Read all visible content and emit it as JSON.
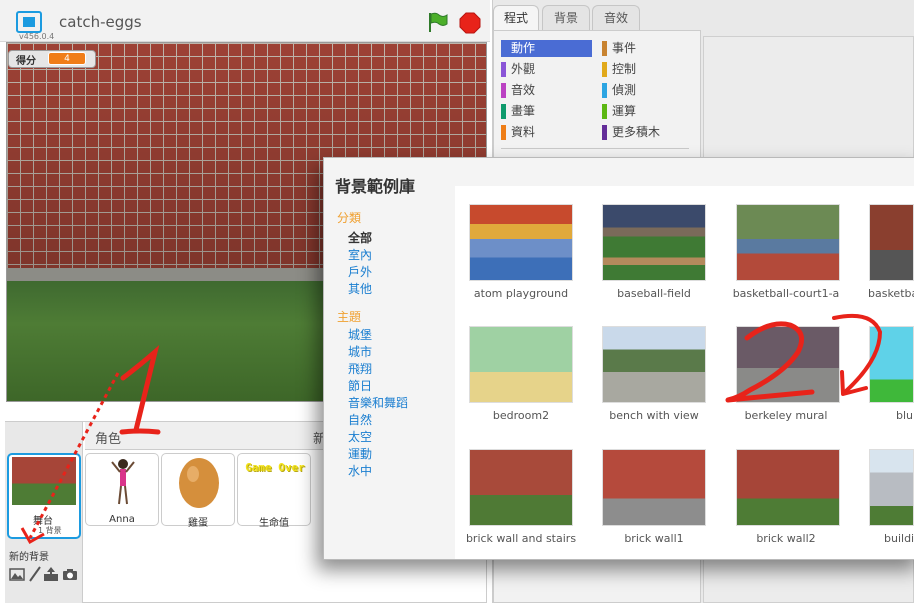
{
  "header": {
    "project_title": "catch-eggs",
    "version": "v456.0.4",
    "green_flag_icon": "green-flag-icon",
    "stop_icon": "stop-sign-icon"
  },
  "stage": {
    "score_label": "得分",
    "score_value": "4"
  },
  "sprites_pane": {
    "heading": "角色",
    "new_sprite_label": "新",
    "stage_thumb_name": "舞台",
    "stage_thumb_sub": "1 背景",
    "new_backdrop_label": "新的背景",
    "sprites": [
      {
        "name": "Anna"
      },
      {
        "name": "雞蛋"
      },
      {
        "name": "生命值",
        "costume_text": "Game Over"
      }
    ]
  },
  "tabs": [
    "程式",
    "背景",
    "音效"
  ],
  "categories": [
    {
      "label": "動作",
      "color": "#4a6cd4"
    },
    {
      "label": "外觀",
      "color": "#8a55d7"
    },
    {
      "label": "音效",
      "color": "#bb42c3"
    },
    {
      "label": "畫筆",
      "color": "#0e9a6c"
    },
    {
      "label": "資料",
      "color": "#ee7d16"
    },
    {
      "label": "事件",
      "color": "#c88330"
    },
    {
      "label": "控制",
      "color": "#e1a91a"
    },
    {
      "label": "偵測",
      "color": "#2ca5e2"
    },
    {
      "label": "運算",
      "color": "#5cb712"
    },
    {
      "label": "更多積木",
      "color": "#632d99"
    }
  ],
  "library": {
    "title": "背景範例庫",
    "category_heading": "分類",
    "categories": [
      "全部",
      "室內",
      "戶外",
      "其他"
    ],
    "theme_heading": "主題",
    "themes": [
      "城堡",
      "城市",
      "飛翔",
      "節日",
      "音樂和舞蹈",
      "自然",
      "太空",
      "運動",
      "水中"
    ],
    "tiles": [
      "atom playground",
      "baseball-field",
      "basketball-court1-a",
      "basketba",
      "bedroom2",
      "bench with view",
      "berkeley mural",
      "blu",
      "brick wall and stairs",
      "brick wall1",
      "brick wall2",
      "buildin"
    ]
  },
  "annotations": [
    "1",
    "2"
  ],
  "colors": {
    "accent": "#1c9be0",
    "score_badge": "#f07d18",
    "annotation": "#e8231a"
  }
}
